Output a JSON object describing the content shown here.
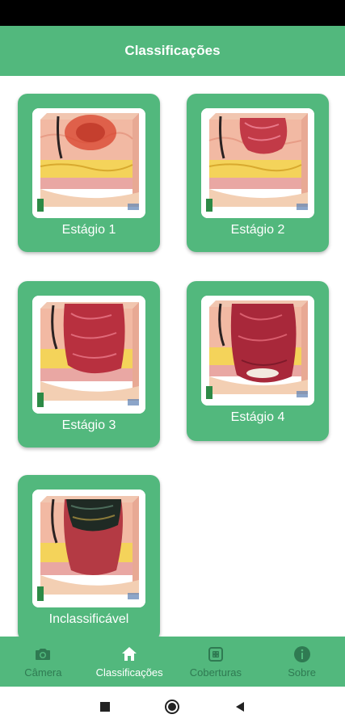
{
  "app_bar": {
    "title": "Classificações"
  },
  "cards": [
    {
      "label": "Estágio 1",
      "stage": "stage-1"
    },
    {
      "label": "Estágio 2",
      "stage": "stage-2"
    },
    {
      "label": "Estágio 3",
      "stage": "stage-3"
    },
    {
      "label": "Estágio 4",
      "stage": "stage-4"
    },
    {
      "label": "Inclassificável",
      "stage": "unstageable"
    }
  ],
  "bottom_nav": {
    "items": [
      {
        "label": "Câmera",
        "icon": "camera-icon",
        "active": false
      },
      {
        "label": "Classificações",
        "icon": "home-icon",
        "active": true
      },
      {
        "label": "Coberturas",
        "icon": "bandage-icon",
        "active": false
      },
      {
        "label": "Sobre",
        "icon": "info-icon",
        "active": false
      }
    ]
  },
  "system_nav": {
    "icons": [
      "recents-icon",
      "home-circle-icon",
      "back-icon"
    ]
  },
  "colors": {
    "primary": "#52b87d",
    "inactive_nav": "#2f7a52",
    "status_bar": "#000000"
  }
}
